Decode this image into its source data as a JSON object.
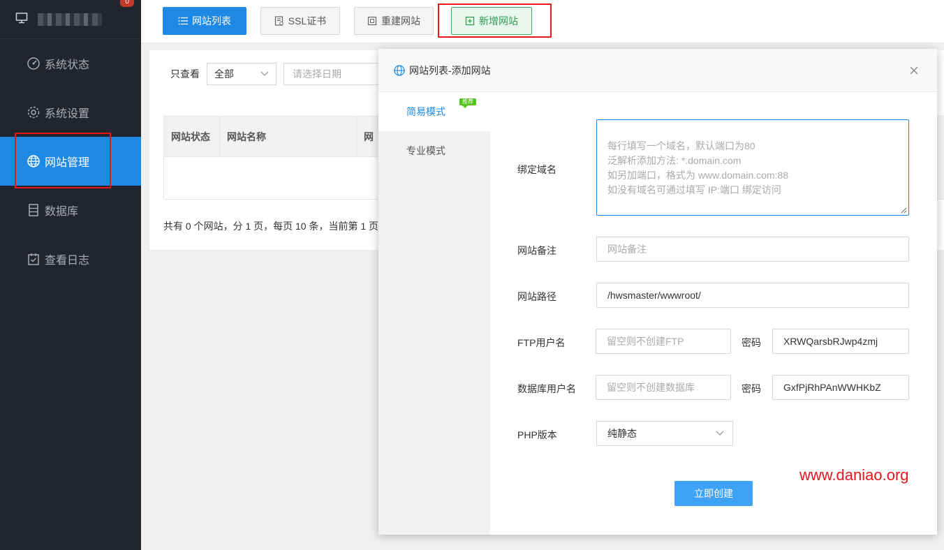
{
  "sidebar": {
    "badge": "0",
    "items": [
      {
        "label": "系统状态",
        "icon": "dashboard-icon"
      },
      {
        "label": "系统设置",
        "icon": "gear-icon"
      },
      {
        "label": "网站管理",
        "icon": "globe-icon"
      },
      {
        "label": "数据库",
        "icon": "database-icon"
      },
      {
        "label": "查看日志",
        "icon": "calendar-check-icon"
      }
    ],
    "active_index": 2,
    "accent_color": "#1e88e5"
  },
  "toolbar": {
    "site_list": "网站列表",
    "ssl": "SSL证书",
    "rebuild": "重建网站",
    "add_site": "新增网站"
  },
  "filter": {
    "label": "只查看",
    "select_value": "全部",
    "date_placeholder": "请选择日期"
  },
  "table": {
    "columns": [
      "网站状态",
      "网站名称",
      "网"
    ]
  },
  "pager": {
    "text": "共有 0 个网站，分 1 页，每页 10 条，当前第 1 页"
  },
  "modal": {
    "title": "网站列表-添加网站",
    "tabs": [
      {
        "label": "简易模式",
        "tag": "推荐"
      },
      {
        "label": "专业模式"
      }
    ],
    "fields": {
      "domain_label": "绑定域名",
      "domain_placeholder_lines": [
        "每行填写一个域名，默认端口为80",
        "泛解析添加方法: *.domain.com",
        "如另加端口，格式为 www.domain.com:88",
        "如没有域名可通过填写 IP:端口 绑定访问"
      ],
      "remark_label": "网站备注",
      "remark_placeholder": "网站备注",
      "path_label": "网站路径",
      "path_value": "/hwsmaster/wwwroot/",
      "ftp_label": "FTP用户名",
      "ftp_placeholder": "留空则不创建FTP",
      "ftp_password_label": "密码",
      "ftp_password_value": "XRWQarsbRJwp4zmj",
      "db_label": "数据库用户名",
      "db_placeholder": "留空则不创建数据库",
      "db_password_label": "密码",
      "db_password_value": "GxfPjRhPAnWWHKbZ",
      "php_label": "PHP版本",
      "php_value": "纯静态"
    },
    "submit": "立即创建"
  },
  "watermark": "www.daniao.org"
}
